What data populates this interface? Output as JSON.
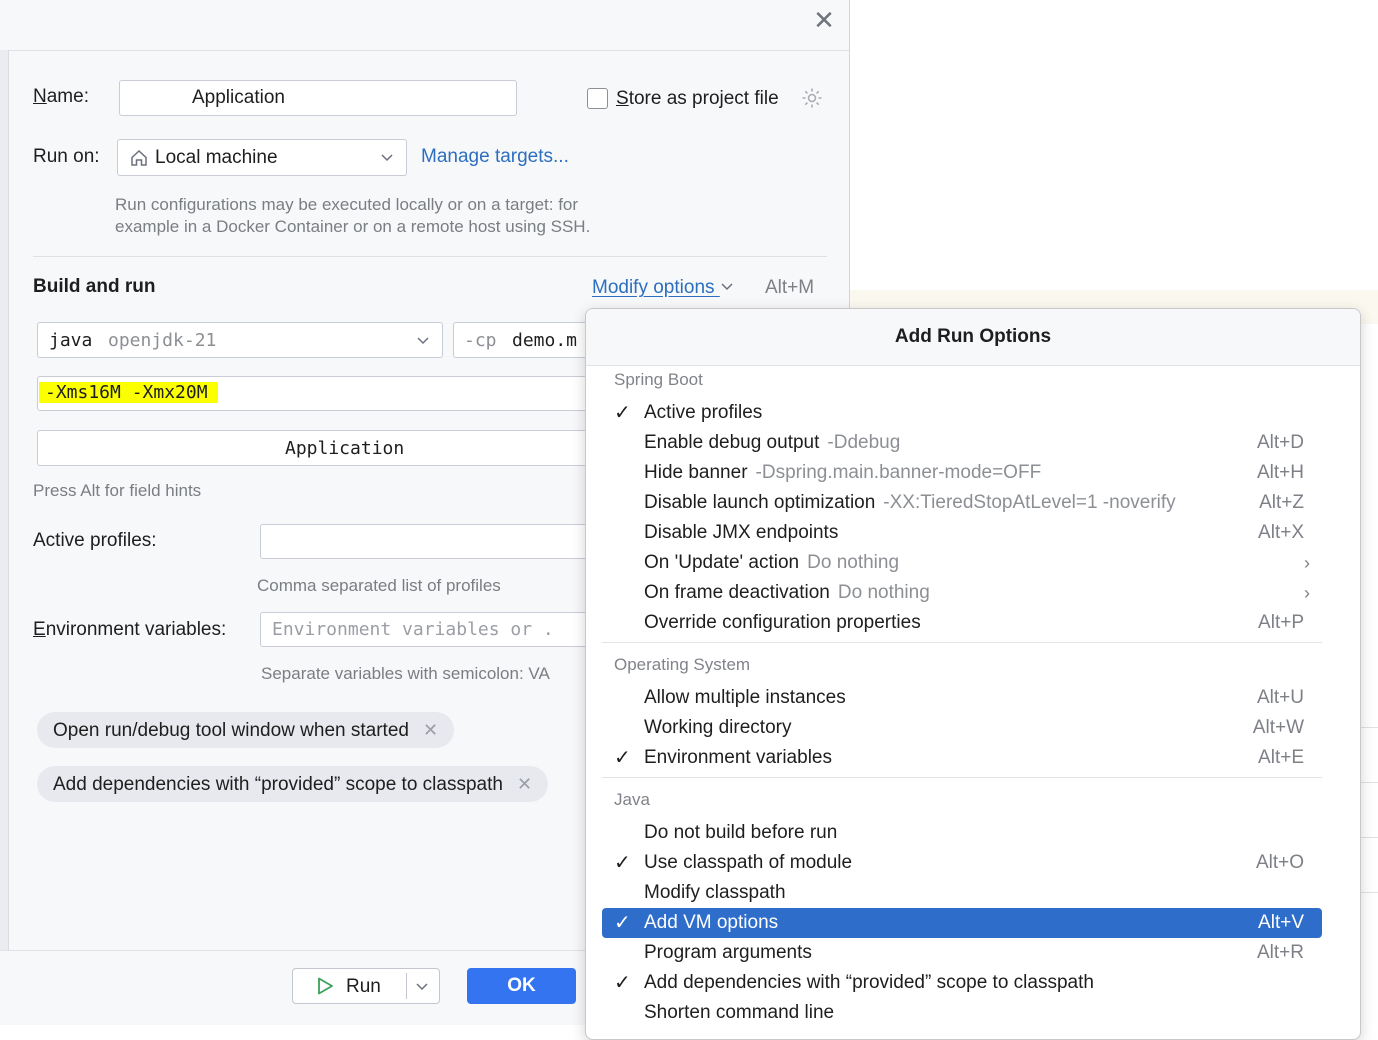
{
  "form": {
    "name_label": "Name:",
    "name_value": "Application",
    "store_label": "Store as project file",
    "run_on_label": "Run on:",
    "run_on_value": "Local machine",
    "manage_targets": "Manage targets...",
    "run_on_hint_1": "Run configurations may be executed locally or on a target: for",
    "run_on_hint_2": "example in a Docker Container or on a remote host using SSH.",
    "build_and_run": "Build and run",
    "modify_options": "Modify options",
    "modify_shortcut": "Alt+M",
    "java_label": "java",
    "jdk_value": "openjdk-21",
    "cp_flag": "-cp",
    "cp_value": "demo.m",
    "vm_options": "-Xms16M -Xmx20M",
    "main_class": "Application",
    "field_hints": "Press Alt for field hints",
    "active_profiles_label": "Active profiles:",
    "profiles_hint": "Comma separated list of profiles",
    "env_label": "Environment variables:",
    "env_placeholder": "Environment variables or .",
    "env_hint": "Separate variables with semicolon: VA",
    "chip_1": "Open run/debug tool window when started",
    "chip_2": "Add dependencies with “provided” scope to classpath",
    "run_button": "Run",
    "ok_button": "OK"
  },
  "popup": {
    "title": "Add Run Options",
    "sections": [
      {
        "title": "Spring Boot"
      },
      {
        "title": "Operating System"
      },
      {
        "title": "Java"
      }
    ],
    "items": [
      {
        "label": "Active profiles",
        "detail": "",
        "shortcut": "",
        "checked": "✓"
      },
      {
        "label": "Enable debug output",
        "detail": "-Ddebug",
        "shortcut": "Alt+D",
        "checked": ""
      },
      {
        "label": "Hide banner",
        "detail": "-Dspring.main.banner-mode=OFF",
        "shortcut": "Alt+H",
        "checked": ""
      },
      {
        "label": "Disable launch optimization",
        "detail": "-XX:TieredStopAtLevel=1 -noverify",
        "shortcut": "Alt+Z",
        "checked": ""
      },
      {
        "label": "Disable JMX endpoints",
        "detail": "",
        "shortcut": "Alt+X",
        "checked": ""
      },
      {
        "label": "On 'Update' action",
        "detail": "Do nothing",
        "shortcut": "",
        "checked": ""
      },
      {
        "label": "On frame deactivation",
        "detail": "Do nothing",
        "shortcut": "",
        "checked": ""
      },
      {
        "label": "Override configuration properties",
        "detail": "",
        "shortcut": "Alt+P",
        "checked": ""
      },
      {
        "label": "Allow multiple instances",
        "detail": "",
        "shortcut": "Alt+U",
        "checked": ""
      },
      {
        "label": "Working directory",
        "detail": "",
        "shortcut": "Alt+W",
        "checked": ""
      },
      {
        "label": "Environment variables",
        "detail": "",
        "shortcut": "Alt+E",
        "checked": "✓"
      },
      {
        "label": "Do not build before run",
        "detail": "",
        "shortcut": "",
        "checked": ""
      },
      {
        "label": "Use classpath of module",
        "detail": "",
        "shortcut": "Alt+O",
        "checked": "✓"
      },
      {
        "label": "Modify classpath",
        "detail": "",
        "shortcut": "",
        "checked": ""
      },
      {
        "label": "Add VM options",
        "detail": "",
        "shortcut": "Alt+V",
        "checked": "✓"
      },
      {
        "label": "Program arguments",
        "detail": "",
        "shortcut": "Alt+R",
        "checked": ""
      },
      {
        "label": "Add dependencies with “provided” scope to classpath",
        "detail": "",
        "shortcut": "",
        "checked": "✓"
      },
      {
        "label": "Shorten command line",
        "detail": "",
        "shortcut": "",
        "checked": ""
      }
    ]
  },
  "colors": {
    "accent": "#3574f0",
    "selection": "#2e6dca",
    "highlight": "#ffff00",
    "link": "#2d6fbe"
  },
  "icons": [
    "close-icon",
    "gear-icon",
    "home-icon",
    "chevron-down-icon",
    "checkmark-icon",
    "play-icon",
    "chevron-right-icon"
  ]
}
